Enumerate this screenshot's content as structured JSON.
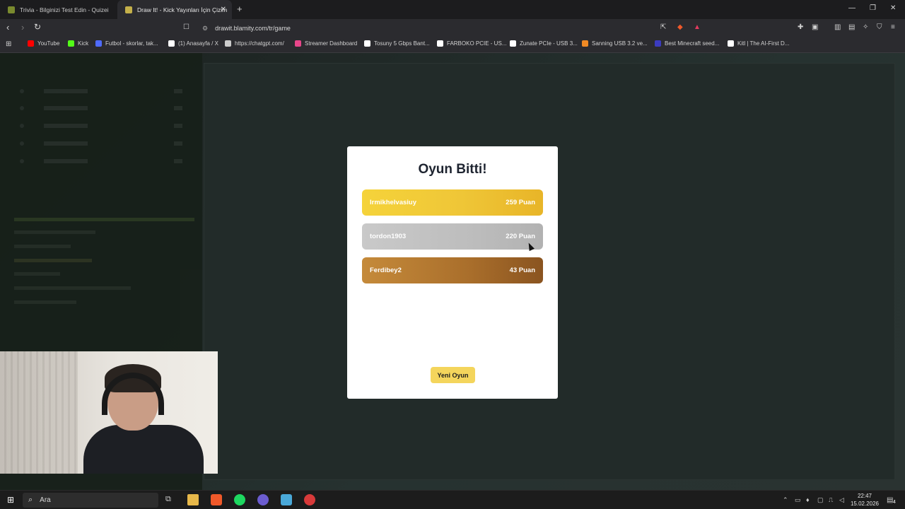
{
  "browser": {
    "tabs": [
      {
        "title": "Trivia - Bilginizi Test Edin - Quizei",
        "active": false
      },
      {
        "title": "Draw It! - Kick Yayınları İçin Çizim",
        "active": true
      }
    ],
    "new_tab": "+",
    "url": "drawit.blamity.com/tr/game",
    "bookmarks": [
      {
        "label": "YouTube",
        "color": "#ff0000"
      },
      {
        "label": "Kick",
        "color": "#53fc18"
      },
      {
        "label": "Futbol - skorlar, tak...",
        "color": "#4f6bff"
      },
      {
        "label": "(1) Anasayfa / X",
        "color": "#ffffff"
      },
      {
        "label": "https://chatgpt.com/",
        "color": "#cccccc"
      },
      {
        "label": "Streamer Dashboard",
        "color": "#e8468a"
      },
      {
        "label": "Tosuny 5 Gbps Bant...",
        "color": "#ffffff"
      },
      {
        "label": "FARBOKO PCIE - US...",
        "color": "#ffffff"
      },
      {
        "label": "Zunate PCIe - USB 3...",
        "color": "#ffffff"
      },
      {
        "label": "Sanning USB 3.2 ve...",
        "color": "#f08a24"
      },
      {
        "label": "Best Minecraft seed...",
        "color": "#3b3bbf"
      },
      {
        "label": "Kitl | The AI-First D...",
        "color": "#ffffff"
      }
    ]
  },
  "modal": {
    "title": "Oyun Bitti!",
    "results": [
      {
        "name": "Irmikhelvasiuy",
        "score": "259 Puan"
      },
      {
        "name": "tordon1903",
        "score": "220 Puan"
      },
      {
        "name": "Ferdibey2",
        "score": "43 Puan"
      }
    ],
    "new_game_label": "Yeni Oyun"
  },
  "taskbar": {
    "search_placeholder": "Ara",
    "time": "22:47",
    "date": "15.02.2026",
    "notification_count": "4"
  },
  "colors": {
    "gold": "#f0c733",
    "silver": "#bdbdbd",
    "bronze": "#a96e2b",
    "button": "#f4d55c"
  }
}
